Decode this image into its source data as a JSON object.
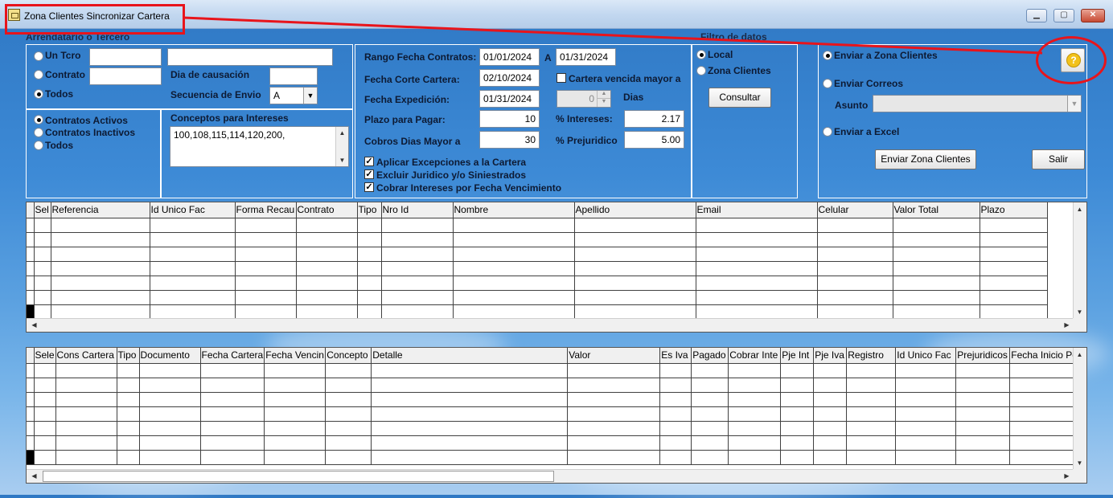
{
  "window": {
    "title": "Zona Clientes Sincronizar Cartera"
  },
  "groups": {
    "arrendatario": "Arrendatario o Tercero",
    "filtro": "Filtro de datos",
    "conceptos": "Conceptos para Intereses"
  },
  "arrendatario": {
    "un_tcro": "Un Tcro",
    "contrato": "Contrato",
    "todos": "Todos",
    "dia_causacion_label": "Dia de causación",
    "secuencia_label": "Secuencia de Envio",
    "secuencia_value": "A"
  },
  "contratos": {
    "activos": "Contratos Activos",
    "inactivos": "Contratos Inactivos",
    "todos": "Todos"
  },
  "conceptos_value": "100,108,115,114,120,200,",
  "fechas": {
    "rango_label": "Rango Fecha Contratos:",
    "rango_desde": "01/01/2024",
    "a_label": "A",
    "rango_hasta": "01/31/2024",
    "corte_label": "Fecha Corte Cartera:",
    "corte_value": "02/10/2024",
    "vencida_label": "Cartera vencida mayor a",
    "expedicion_label": "Fecha Expedición:",
    "expedicion_value": "01/31/2024",
    "dias_value": "0",
    "dias_label": "Dias",
    "plazo_label": "Plazo para Pagar:",
    "plazo_value": "10",
    "intereses_label": "% Intereses:",
    "intereses_value": "2.17",
    "cobros_label": "Cobros Dias Mayor a",
    "cobros_value": "30",
    "prejuridico_label": "% Prejuridico",
    "prejuridico_value": "5.00"
  },
  "checks": {
    "excepciones": "Aplicar Excepciones a la Cartera",
    "excluir": "Excluir Juridico y/o Siniestrados",
    "cobrar": "Cobrar Intereses por Fecha Vencimiento"
  },
  "filtro": {
    "local": "Local",
    "zona": "Zona Clientes",
    "consultar": "Consultar"
  },
  "envio": {
    "zona": "Enviar a Zona Clientes",
    "correos": "Enviar Correos",
    "asunto_label": "Asunto",
    "excel": "Enviar a Excel",
    "enviar_btn": "Enviar Zona Clientes",
    "salir_btn": "Salir",
    "help_glyph": "?"
  },
  "grid1": {
    "columns": [
      "Sel",
      "Referencia",
      "Id Unico Fac",
      "Forma Recau",
      "Contrato",
      "Tipo",
      "Nro Id",
      "Nombre",
      "Apellido",
      "Email",
      "Celular",
      "Valor Total",
      "Plazo"
    ]
  },
  "grid2": {
    "columns": [
      "Sele",
      "Cons Cartera",
      "Tipo",
      "Documento",
      "Fecha Cartera",
      "Fecha Vencin",
      "Concepto",
      "Detalle",
      "Valor",
      "Es Iva",
      "Pagado",
      "Cobrar Inte",
      "Pje Int",
      "Pje Iva",
      "Registro",
      "Id Unico Fac",
      "Prejuridicos",
      "Fecha Inicio Pe"
    ]
  },
  "colors": {
    "annotation_red": "#e8141b",
    "desktop_blue": "#3d8ad6"
  }
}
